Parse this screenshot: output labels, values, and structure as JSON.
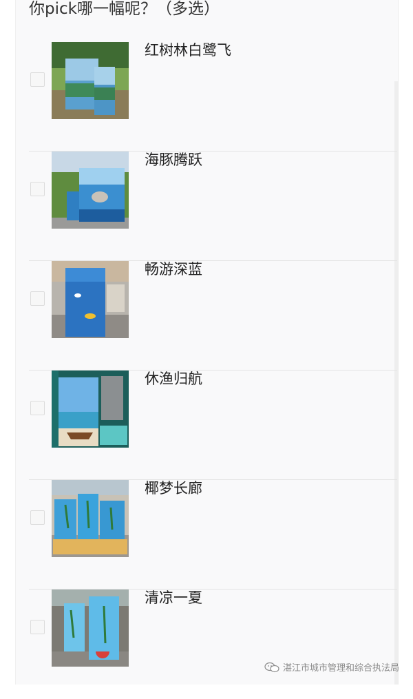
{
  "question": {
    "title": "你pick哪一幅呢？（多选）"
  },
  "options": [
    {
      "label": "红树林白鹭飞",
      "checked": false,
      "image": "mangrove-egret-painted-box"
    },
    {
      "label": "海豚腾跃",
      "checked": false,
      "image": "dolphin-leap-painted-box"
    },
    {
      "label": "畅游深蓝",
      "checked": false,
      "image": "deep-blue-fish-painted-box"
    },
    {
      "label": "休渔归航",
      "checked": false,
      "image": "fishing-boat-painted-box"
    },
    {
      "label": "椰梦长廊",
      "checked": false,
      "image": "coconut-corridor-painted-boxes"
    },
    {
      "label": "清凉一夏",
      "checked": false,
      "image": "cool-summer-painted-box"
    }
  ],
  "watermark": {
    "text": "湛江市城市管理和综合执法局",
    "icon": "wechat-icon"
  },
  "colors": {
    "card_background": "#f9f9fa",
    "separator": "#e4e4e4",
    "text": "#222222"
  }
}
